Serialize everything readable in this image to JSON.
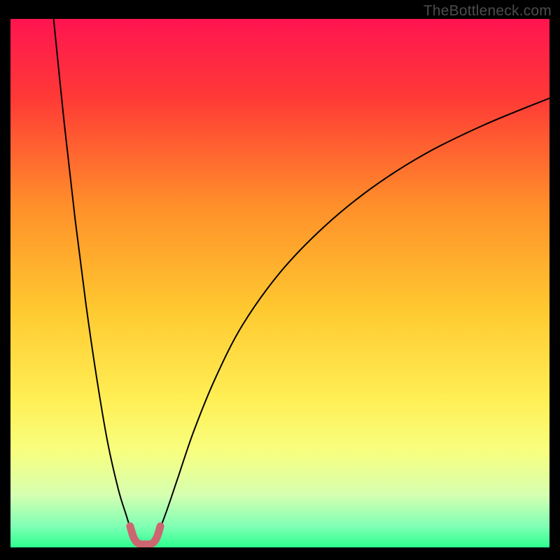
{
  "watermark": "TheBottleneck.com",
  "chart_data": {
    "type": "line",
    "title": "",
    "xlabel": "",
    "ylabel": "",
    "xlim": [
      0,
      100
    ],
    "ylim": [
      0,
      100
    ],
    "grid": false,
    "legend": false,
    "gradient_stops": [
      {
        "offset": 0.0,
        "color": "#ff1450"
      },
      {
        "offset": 0.15,
        "color": "#ff3a36"
      },
      {
        "offset": 0.35,
        "color": "#ff8e2a"
      },
      {
        "offset": 0.55,
        "color": "#ffc930"
      },
      {
        "offset": 0.72,
        "color": "#ffef55"
      },
      {
        "offset": 0.82,
        "color": "#f7ff80"
      },
      {
        "offset": 0.9,
        "color": "#d6ffb0"
      },
      {
        "offset": 0.96,
        "color": "#7fffb5"
      },
      {
        "offset": 1.0,
        "color": "#2dff8e"
      }
    ],
    "series": [
      {
        "name": "left-curve",
        "color": "#000000",
        "width": 2,
        "x": [
          8.0,
          10.0,
          12.0,
          14.0,
          16.0,
          18.0,
          20.0,
          21.5,
          22.5,
          23.2
        ],
        "values": [
          100.0,
          80.0,
          62.0,
          46.0,
          32.0,
          20.0,
          11.0,
          6.0,
          2.8,
          1.2
        ]
      },
      {
        "name": "right-curve",
        "color": "#000000",
        "width": 2,
        "x": [
          26.5,
          27.5,
          29.0,
          31.0,
          34.0,
          38.0,
          43.0,
          50.0,
          58.0,
          67.0,
          77.0,
          88.0,
          100.0
        ],
        "values": [
          1.2,
          3.0,
          7.0,
          13.0,
          22.0,
          32.0,
          42.0,
          52.0,
          60.5,
          68.0,
          74.5,
          80.0,
          85.0
        ]
      }
    ],
    "highlight_band": {
      "name": "u-highlight",
      "color": "#cc6670",
      "width": 11,
      "x": [
        22.2,
        22.8,
        23.5,
        24.2,
        25.0,
        25.8,
        26.5,
        27.2,
        27.8
      ],
      "values": [
        4.0,
        2.0,
        0.9,
        0.6,
        0.6,
        0.6,
        0.9,
        2.0,
        4.0
      ]
    }
  }
}
